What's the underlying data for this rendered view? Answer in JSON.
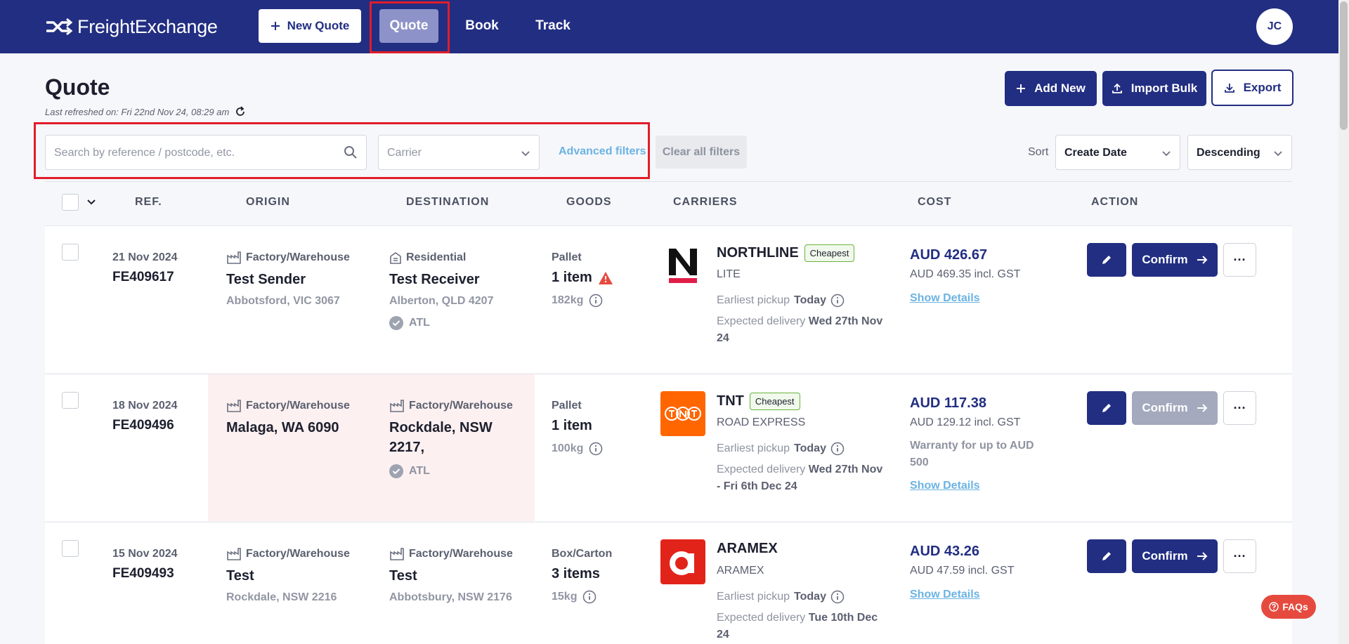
{
  "nav": {
    "brand": "FreightExchange",
    "new_quote_label": "New Quote",
    "tabs": [
      {
        "label": "Quote",
        "active": true
      },
      {
        "label": "Book"
      },
      {
        "label": "Track"
      }
    ],
    "user_initials": "JC"
  },
  "header": {
    "title": "Quote",
    "last_refreshed": "Last refreshed on: Fri 22nd Nov 24, 08:29 am",
    "add_new_label": "Add New",
    "import_bulk_label": "Import Bulk",
    "export_label": "Export"
  },
  "filters": {
    "search_placeholder": "Search by reference / postcode, etc.",
    "carrier_placeholder": "Carrier",
    "advanced_label": "Advanced filters",
    "clear_label": "Clear all filters",
    "sort_label": "Sort",
    "sort_by": "Create Date",
    "sort_order": "Descending"
  },
  "table": {
    "columns": [
      "REF.",
      "ORIGIN",
      "DESTINATION",
      "GOODS",
      "CARRIERS",
      "COST",
      "ACTION"
    ],
    "rows": [
      {
        "date": "21 Nov 2024",
        "ref": "FE409617",
        "origin_type": "Factory/Warehouse",
        "origin_name": "Test Sender",
        "origin_sub": "Abbotsford, VIC 3067",
        "dest_type": "Residential",
        "dest_name": "Test Receiver",
        "dest_sub": "Alberton, QLD 4207",
        "atl": "ATL",
        "goods_type": "Pallet",
        "goods_qty": "1 item",
        "goods_weight": "182kg",
        "carrier": "NORTHLINE",
        "badge": "Cheapest",
        "service": "LITE",
        "pickup_label": "Earliest pickup",
        "pickup_value": "Today",
        "delivery_label": "Expected delivery",
        "delivery_value": "Wed 27th Nov 24",
        "cost": "AUD 426.67",
        "cost_gst": "AUD 469.35 incl. GST",
        "show_details": "Show Details",
        "confirm": "Confirm"
      },
      {
        "date": "18 Nov 2024",
        "ref": "FE409496",
        "origin_type": "Factory/Warehouse",
        "origin_name": "Malaga, WA 6090",
        "dest_type": "Factory/Warehouse",
        "dest_name": "Rockdale, NSW 2217,",
        "atl": "ATL",
        "goods_type": "Pallet",
        "goods_qty": "1 item",
        "goods_weight": "100kg",
        "carrier": "TNT",
        "badge": "Cheapest",
        "service": "ROAD EXPRESS",
        "pickup_label": "Earliest pickup",
        "pickup_value": "Today",
        "delivery_label": "Expected delivery",
        "delivery_value": "Wed 27th Nov - Fri 6th Dec 24",
        "cost": "AUD 117.38",
        "cost_gst": "AUD 129.12 incl. GST",
        "warranty": "Warranty for up to AUD 500",
        "show_details": "Show Details",
        "confirm": "Confirm"
      },
      {
        "date": "15 Nov 2024",
        "ref": "FE409493",
        "origin_type": "Factory/Warehouse",
        "origin_name": "Test",
        "origin_sub": "Rockdale, NSW 2216",
        "dest_type": "Factory/Warehouse",
        "dest_name": "Test",
        "dest_sub": "Abbotsbury, NSW 2176",
        "goods_type": "Box/Carton",
        "goods_qty": "3 items",
        "goods_weight": "15kg",
        "carrier": "ARAMEX",
        "service": "ARAMEX",
        "pickup_label": "Earliest pickup",
        "pickup_value": "Today",
        "delivery_label": "Expected delivery",
        "delivery_value": "Tue 10th Dec 24",
        "cost": "AUD 43.26",
        "cost_gst": "AUD 47.59 incl. GST",
        "show_details": "Show Details",
        "confirm": "Confirm"
      }
    ]
  },
  "faqs_label": "FAQs",
  "colors": {
    "navy": "#222e82",
    "link": "#6bb3e3",
    "warning": "#e64a3f",
    "highlight": "#e11d2a"
  }
}
